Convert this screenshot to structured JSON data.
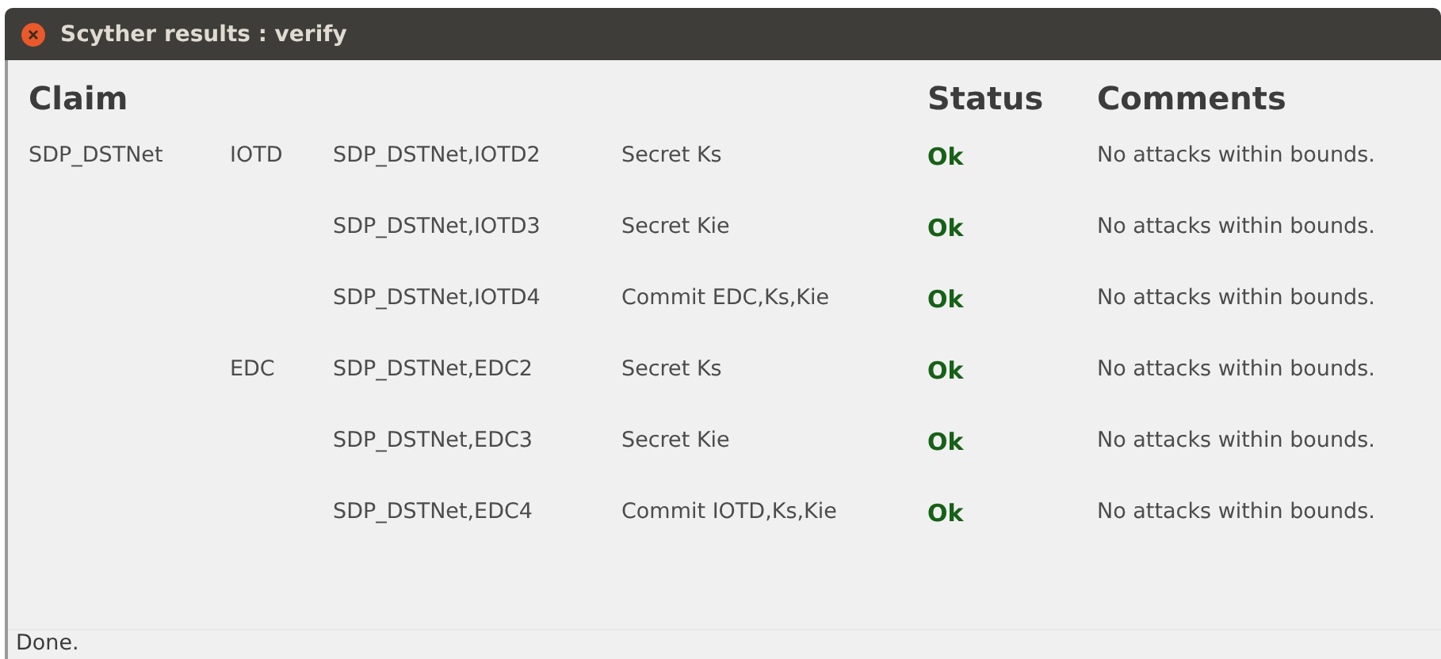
{
  "window": {
    "title": "Scyther results : verify"
  },
  "table": {
    "columns": [
      "Claim",
      "Status",
      "Comments"
    ],
    "rows": [
      {
        "protocol": "SDP_DSTNet",
        "role": "IOTD",
        "claim_id": "SDP_DSTNet,IOTD2",
        "claim": "Secret Ks",
        "status": "Ok",
        "ok": true,
        "comment": "No attacks within bounds."
      },
      {
        "claim_id": "SDP_DSTNet,IOTD3",
        "claim": "Secret Kie",
        "status": "Ok",
        "ok": true,
        "comment": "No attacks within bounds."
      },
      {
        "claim_id": "SDP_DSTNet,IOTD4",
        "claim": "Commit EDC,Ks,Kie",
        "status": "Ok",
        "ok": true,
        "comment": "No attacks within bounds."
      },
      {
        "role": "EDC",
        "claim_id": "SDP_DSTNet,EDC2",
        "claim": "Secret Ks",
        "status": "Ok",
        "ok": true,
        "comment": "No attacks within bounds."
      },
      {
        "claim_id": "SDP_DSTNet,EDC3",
        "claim": "Secret Kie",
        "status": "Ok",
        "ok": true,
        "comment": "No attacks within bounds."
      },
      {
        "claim_id": "SDP_DSTNet,EDC4",
        "claim": "Commit IOTD,Ks,Kie",
        "status": "Ok",
        "ok": true,
        "comment": "No attacks within bounds."
      }
    ]
  },
  "status_bar": "Done."
}
